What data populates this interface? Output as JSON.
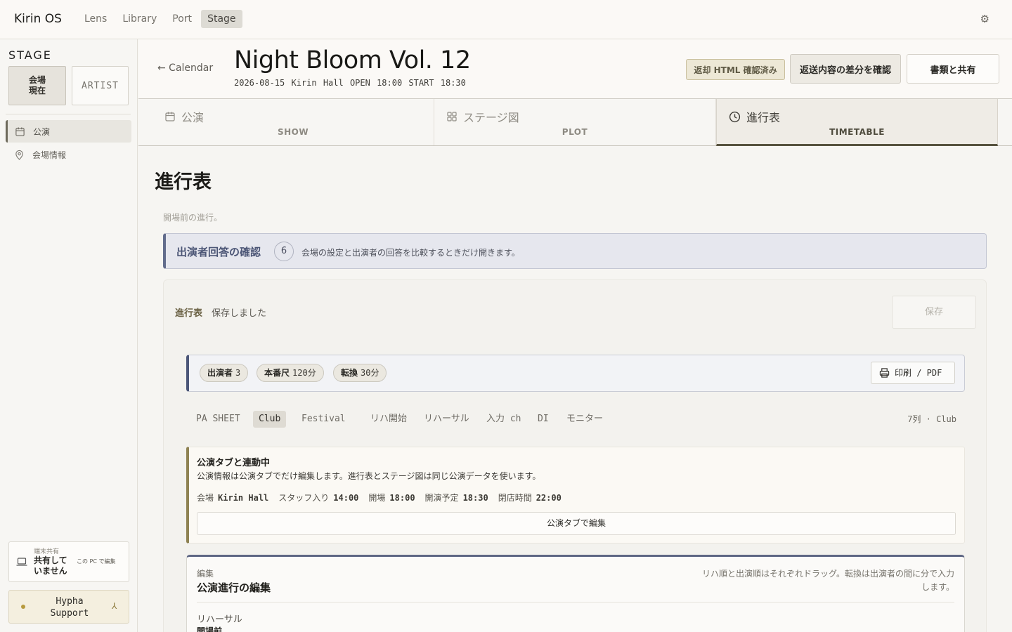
{
  "app": {
    "brand": "Kirin OS",
    "nav": [
      "Lens",
      "Library",
      "Port",
      "Stage"
    ],
    "active_nav": "Stage"
  },
  "sidebar": {
    "title": "STAGE",
    "role_venue": "会場\n現在",
    "role_venue_line1": "会場",
    "role_venue_line2": "現在",
    "role_artist": "ARTIST",
    "items": [
      {
        "label": "公演",
        "icon": "calendar-icon",
        "active": true
      },
      {
        "label": "会場情報",
        "icon": "map-pin-icon",
        "active": false
      }
    ],
    "share": {
      "caption": "端末共有",
      "status": "共有して いません",
      "action": "この PC で編集"
    },
    "support": {
      "label": "Hypha Support",
      "arrow": "⅄"
    }
  },
  "event": {
    "back_label": "← Calendar",
    "title": "Night Bloom Vol. 12",
    "meta": "2026-08-15  Kirin Hall  OPEN 18:00  START 18:30",
    "badge": "返却 HTML 確認済み",
    "diff_button": "返送内容の差分を確認",
    "share_button": "書類と共有"
  },
  "tabs": [
    {
      "label": "公演",
      "sub": "SHOW",
      "icon": "calendar-icon"
    },
    {
      "label": "ステージ図",
      "sub": "PLOT",
      "icon": "grid-icon"
    },
    {
      "label": "進行表",
      "sub": "TIMETABLE",
      "icon": "clock-icon",
      "active": true
    }
  ],
  "main": {
    "heading": "進行表",
    "note": "開場前の進行。",
    "alert": {
      "title": "出演者回答の確認",
      "count": "6",
      "desc": "会場の設定と出演者の回答を比較するときだけ開きます。"
    },
    "card": {
      "label": "進行表",
      "status": "保存しました",
      "save_button": "保存",
      "summary": {
        "pills": [
          {
            "key": "出演者",
            "value": "3"
          },
          {
            "key": "本番尺",
            "value": "120分"
          },
          {
            "key": "転換",
            "value": "30分"
          }
        ],
        "print_button": "印刷 / PDF"
      },
      "filters": [
        "PA SHEET",
        "Club",
        "Festival",
        "リハ開始",
        "リハーサル",
        "入力 ch",
        "DI",
        "モニター"
      ],
      "active_filter": "Club",
      "column_count": "7列 · Club",
      "linked": {
        "title": "公演タブと連動中",
        "desc": "公演情報は公演タブでだけ編集します。進行表とステージ図は同じ公演データを使います。",
        "times": [
          {
            "key": "会場",
            "value": "Kirin Hall"
          },
          {
            "key": "スタッフ入り",
            "value": "14:00"
          },
          {
            "key": "開場",
            "value": "18:00"
          },
          {
            "key": "開演予定",
            "value": "18:30"
          },
          {
            "key": "閉店時間",
            "value": "22:00"
          }
        ],
        "edit_button": "公演タブで編集"
      },
      "editor": {
        "caption": "編集",
        "title": "公演進行の編集",
        "hint": "リハ順と出演順はそれぞれドラッグ。転換は出演者の間に分で入力します。",
        "section": "リハーサル",
        "subsection": "開場前"
      }
    }
  },
  "colors": {
    "accent": "#57533f",
    "alert": "#626c8c",
    "linked": "#8e8252"
  }
}
